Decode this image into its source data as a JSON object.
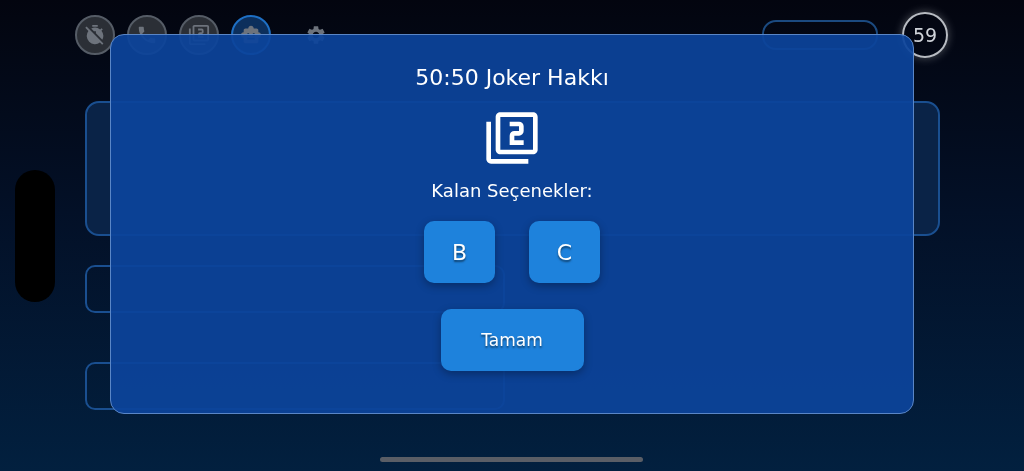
{
  "top_bar": {
    "jokers": [
      {
        "kind": "timer",
        "selected": false
      },
      {
        "kind": "phone",
        "selected": false
      },
      {
        "kind": "fifty",
        "selected": false
      },
      {
        "kind": "robot",
        "selected": true
      }
    ],
    "timer": "59"
  },
  "dialog": {
    "title": "50:50 Joker Hakkı",
    "subtitle": "Kalan Seçenekler:",
    "choices": [
      "B",
      "C"
    ],
    "button": "Tamam"
  }
}
